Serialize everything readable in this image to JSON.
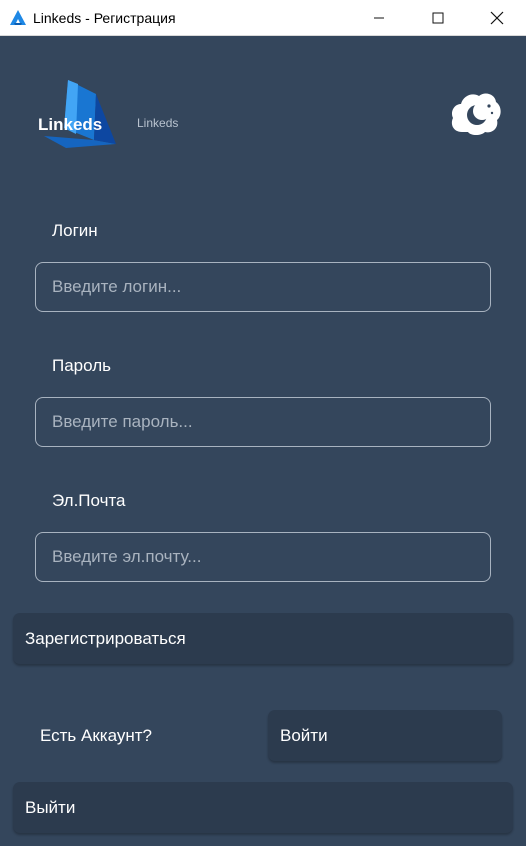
{
  "window": {
    "title": "Linkeds - Регистрация",
    "icons": {
      "app": "linkeds-app-icon",
      "minimize": "minimize-icon",
      "maximize": "maximize-icon",
      "close": "close-icon"
    }
  },
  "header": {
    "logo_text": "Linkeds",
    "caption": "Linkeds",
    "theme_icon": "moon-cloud-icon"
  },
  "form": {
    "login": {
      "label": "Логин",
      "placeholder": "Введите логин...",
      "value": ""
    },
    "password": {
      "label": "Пароль",
      "placeholder": "Введите пароль...",
      "value": ""
    },
    "email": {
      "label": "Эл.Почта",
      "placeholder": "Введите эл.почту...",
      "value": ""
    }
  },
  "actions": {
    "register_label": "Зарегистрироваться",
    "has_account_text": "Есть Аккаунт?",
    "login_label": "Войти",
    "exit_label": "Выйти"
  },
  "colors": {
    "background": "#34465c",
    "button": "#2c3b4e",
    "input_border": "#a8b3c0",
    "logo_blue": "#1e88e5"
  }
}
